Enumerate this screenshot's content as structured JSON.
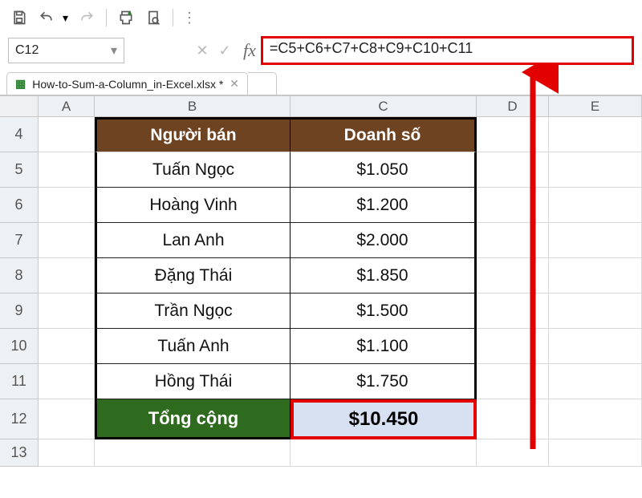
{
  "toolbar": {
    "icons": [
      "save-icon",
      "undo-icon",
      "redo-icon",
      "print-icon",
      "print-preview-icon",
      "more-icon"
    ]
  },
  "namebox": {
    "value": "C12"
  },
  "formula_bar": {
    "cancel": "✕",
    "accept": "✓",
    "fx": "fx",
    "formula": "=C5+C6+C7+C8+C9+C10+C11"
  },
  "file_tab": {
    "name": "How-to-Sum-a-Column_in-Excel.xlsx *"
  },
  "columns": [
    "A",
    "B",
    "C",
    "D",
    "E"
  ],
  "row_headers": [
    "4",
    "5",
    "6",
    "7",
    "8",
    "9",
    "10",
    "11",
    "12",
    "13"
  ],
  "table": {
    "headers": {
      "b": "Người bán",
      "c": "Doanh số"
    },
    "rows": [
      {
        "b": "Tuấn Ngọc",
        "c": "$1.050"
      },
      {
        "b": "Hoàng Vinh",
        "c": "$1.200"
      },
      {
        "b": "Lan Anh",
        "c": "$2.000"
      },
      {
        "b": "Đặng Thái",
        "c": "$1.850"
      },
      {
        "b": "Trần Ngọc",
        "c": "$1.500"
      },
      {
        "b": "Tuấn Anh",
        "c": "$1.100"
      },
      {
        "b": "Hồng Thái",
        "c": "$1.750"
      }
    ],
    "footer": {
      "b": "Tổng cộng",
      "c": "$10.450"
    }
  },
  "chart_data": {
    "type": "table",
    "title": "Doanh số theo Người bán",
    "columns": [
      "Người bán",
      "Doanh số"
    ],
    "rows": [
      [
        "Tuấn Ngọc",
        1050
      ],
      [
        "Hoàng Vinh",
        1200
      ],
      [
        "Lan Anh",
        2000
      ],
      [
        "Đặng Thái",
        1850
      ],
      [
        "Trần Ngọc",
        1500
      ],
      [
        "Tuấn Anh",
        1100
      ],
      [
        "Hồng Thái",
        1750
      ]
    ],
    "total": 10450
  }
}
